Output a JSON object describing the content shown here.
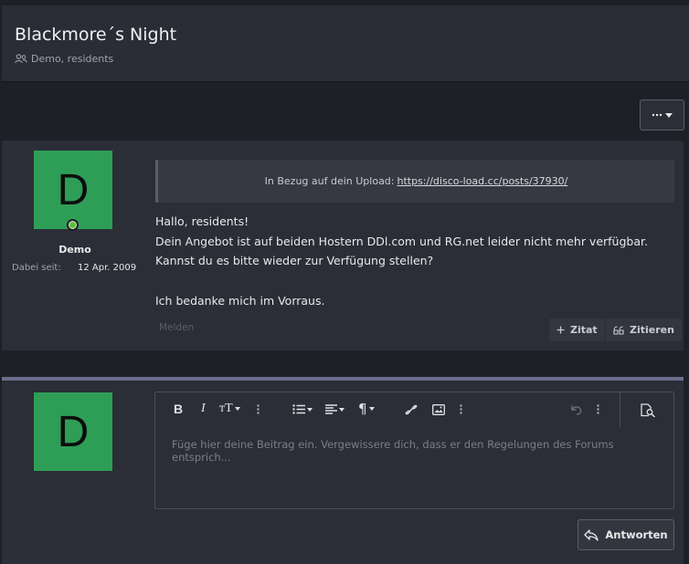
{
  "topic": {
    "title": "Blackmore´s Night",
    "participants": "Demo, residents"
  },
  "post": {
    "avatar_letter": "D",
    "author": "Demo",
    "joined_label": "Dabei seit:",
    "joined_value": "12 Apr. 2009",
    "quote_prefix": "In Bezug auf dein Upload:",
    "quote_link": "https://disco-load.cc/posts/37930/",
    "greeting": "Hallo, residents!",
    "line1": "Dein Angebot ist auf beiden Hostern DDl.com und RG.net leider nicht mehr verfügbar. Kannst du es bitte wieder zur Verfügung stellen?",
    "line2": "Ich bedanke mich im Vorraus.",
    "report_label": "Melden",
    "quote_label": "Zitat",
    "cite_label": "Zitieren"
  },
  "reply": {
    "avatar_letter": "D",
    "placeholder": "Füge hier deine Beitrag ein. Vergewissere dich, dass er den Regelungen des Forums entsprich...",
    "submit_label": "Antworten",
    "toolbar": {
      "bold": "B",
      "italic": "I",
      "text_size": "тT",
      "paragraph": "¶"
    }
  },
  "colors": {
    "avatar_bg": "#2e9e57",
    "online": "#5fbf3a",
    "band": "#6b6f8c"
  }
}
